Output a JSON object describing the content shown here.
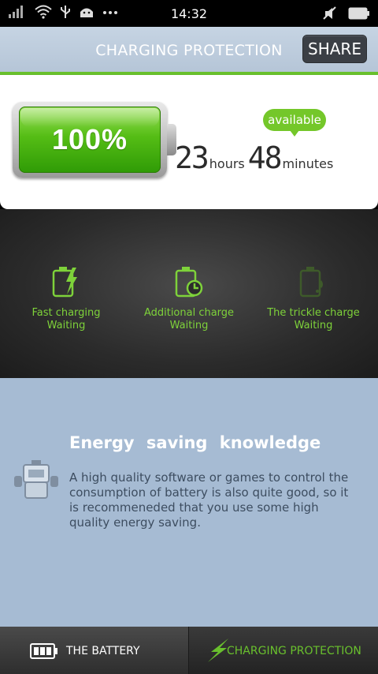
{
  "status_bar": {
    "time": "14:32"
  },
  "header": {
    "title": "CHARGING PROTECTION",
    "share_label": "SHARE"
  },
  "battery": {
    "percent": "100%",
    "level": 1.0,
    "available_label": "available",
    "hours": "23",
    "hours_unit": "hours",
    "minutes": "48",
    "minutes_unit": "minutes"
  },
  "stages": [
    {
      "title": "Fast charging",
      "status": "Waiting",
      "icon": "battery-bolt-icon",
      "active": true
    },
    {
      "title": "Additional charge",
      "status": "Waiting",
      "icon": "battery-clock-icon",
      "active": true
    },
    {
      "title": "The trickle charge",
      "status": "Waiting",
      "icon": "battery-drip-icon",
      "active": false
    }
  ],
  "knowledge": {
    "title": "Energy  saving  knowledge",
    "text": "A high quality software or games to control the consumption of battery is also quite good, so it is recommeneded that you use some high quality energy saving."
  },
  "tabs": [
    {
      "label": "THE BATTERY",
      "icon": "battery-icon",
      "selected": false
    },
    {
      "label": "CHARGING PROTECTION",
      "icon": "lightning-icon",
      "selected": true
    }
  ],
  "colors": {
    "accent": "#69c02d",
    "header": "#b8c8da",
    "knowledge_bg": "#a6bbd3",
    "stage_active": "#7ed23a",
    "stage_inactive": "#3e5a2a"
  }
}
